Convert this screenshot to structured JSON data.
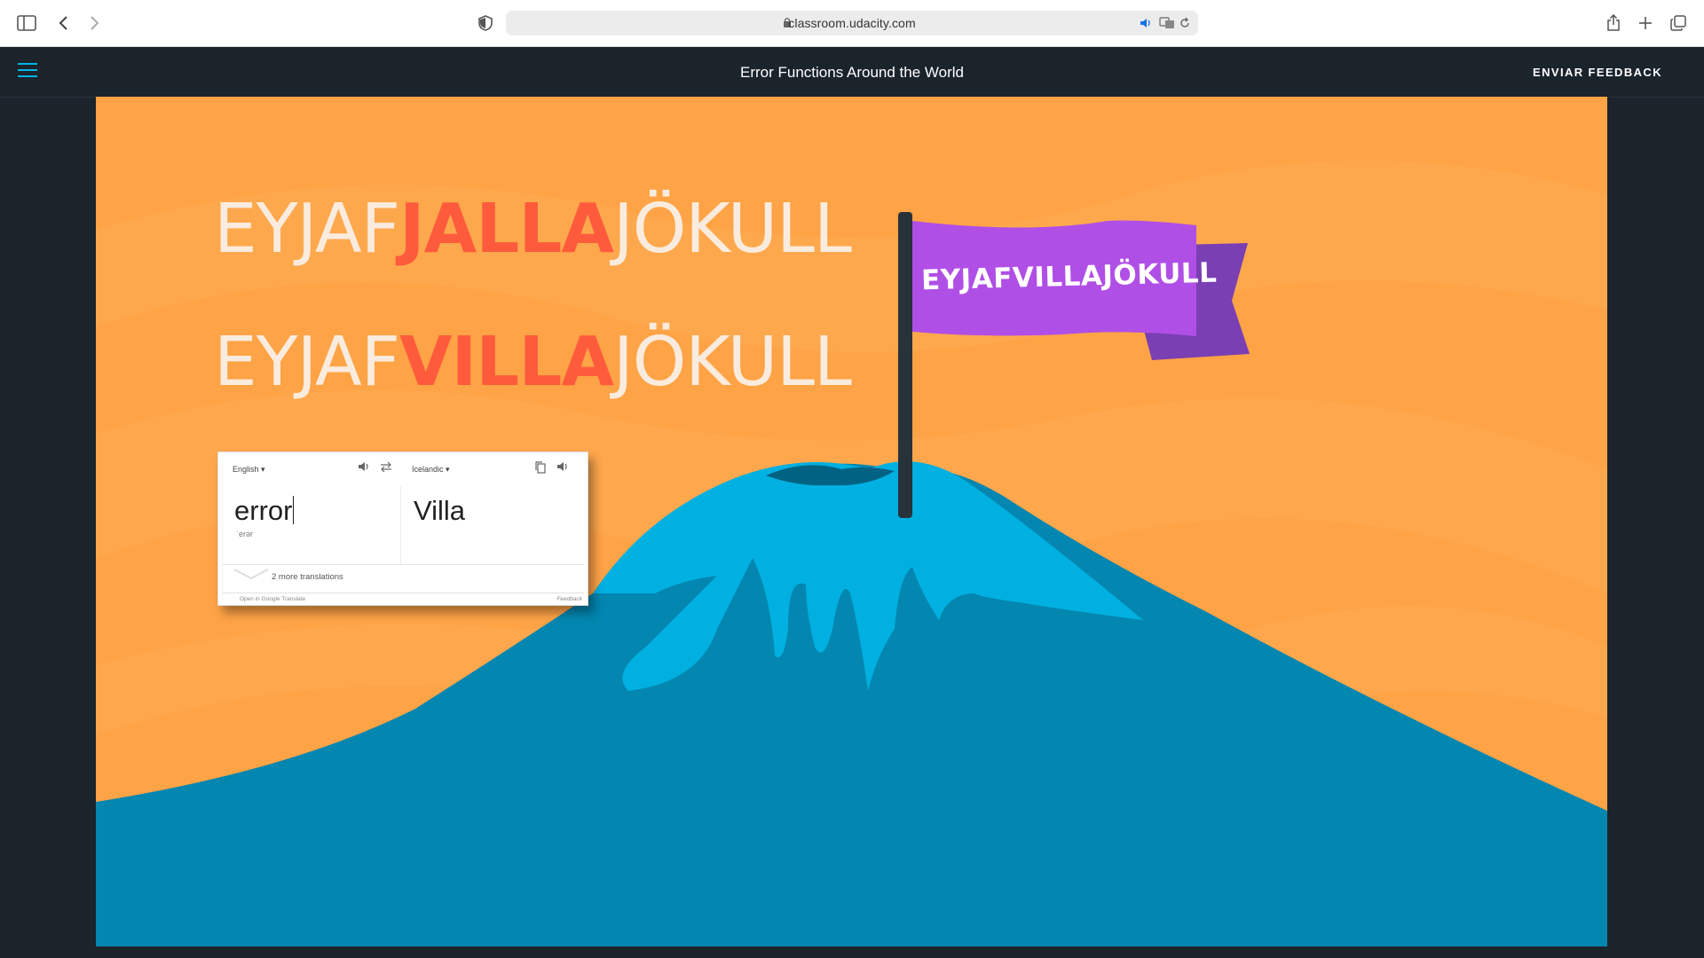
{
  "browser": {
    "url": "classroom.udacity.com"
  },
  "header": {
    "title": "Error Functions Around the World",
    "feedback_label": "ENVIAR FEEDBACK"
  },
  "slide": {
    "word1": {
      "prefix": "EYJAF",
      "highlight": "JALLA",
      "suffix": "JÖKULL"
    },
    "word2": {
      "prefix": "EYJAF",
      "highlight": "VILLA",
      "suffix": "JÖKULL"
    },
    "flag_text": "EYJAFVILLAJÖKULL",
    "translate": {
      "source_lang": "English",
      "target_lang": "Icelandic",
      "source_text": "error",
      "phonetic": "ˈerər",
      "target_text": "Villa",
      "more_translations": "2 more translations",
      "open_link": "Open in Google Translate",
      "feedback": "Feedback"
    }
  },
  "colors": {
    "background_orange": "#fea346",
    "highlight_red": "#fe5b3d",
    "flag_purple": "#b04fe6",
    "volcano_blue": "#0386b0",
    "snow_cyan": "#00b0e0",
    "accent": "#02b3e4"
  }
}
